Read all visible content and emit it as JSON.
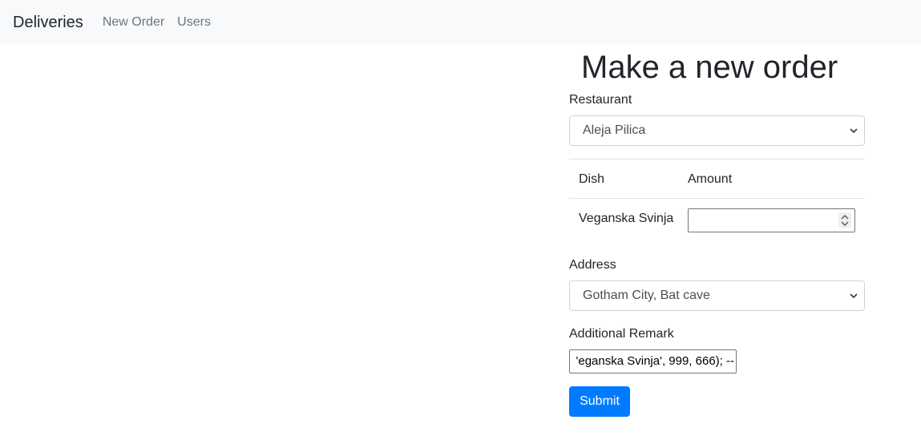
{
  "navbar": {
    "brand": "Deliveries",
    "links": [
      "New Order",
      "Users"
    ]
  },
  "form": {
    "title": "Make a new order",
    "restaurant_label": "Restaurant",
    "restaurant_value": "Aleja Pilica",
    "table": {
      "headers": [
        "Dish",
        "Amount"
      ],
      "rows": [
        {
          "dish": "Veganska Svinja",
          "amount": ""
        }
      ]
    },
    "address_label": "Address",
    "address_value": "Gotham City, Bat cave",
    "remark_label": "Additional Remark",
    "remark_value": "'eganska Svinja', 999, 666); --",
    "submit_label": "Submit"
  },
  "colors": {
    "navbar_bg": "#f8f9fa",
    "primary": "#007bff",
    "muted": "#6c757d"
  }
}
